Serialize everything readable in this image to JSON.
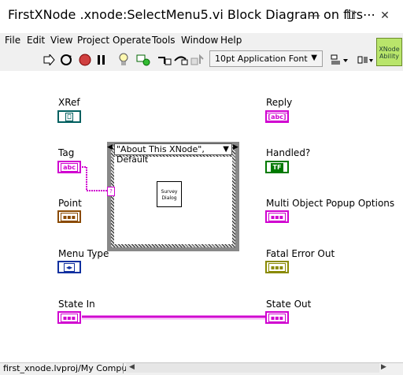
{
  "window": {
    "title": "FirstXNode .xnode:SelectMenu5.vi Block Diagram on firs⋯",
    "minimize": "—",
    "maximize": "☐",
    "close": "✕"
  },
  "menubar": [
    "File",
    "Edit",
    "View",
    "Project",
    "Operate",
    "Tools",
    "Window",
    "Help"
  ],
  "toolbar": {
    "font_select": "10pt Application Font",
    "xnode_ability": [
      "XNode",
      "Ability"
    ]
  },
  "diagram": {
    "terminals": {
      "xref": {
        "label": "XRef",
        "type": "⎕"
      },
      "tag": {
        "label": "Tag",
        "type": "abc"
      },
      "point": {
        "label": "Point",
        "type": "▪▪▪"
      },
      "menu_type": {
        "label": "Menu Type",
        "type": "◂▸"
      },
      "state_in": {
        "label": "State In",
        "type": "▪▪▪"
      },
      "reply": {
        "label": "Reply",
        "type": "[abc]"
      },
      "handled": {
        "label": "Handled?",
        "type": "TF"
      },
      "popup_options": {
        "label": "Multi Object Popup Options",
        "type": "▪▪▪"
      },
      "fatal_error": {
        "label": "Fatal Error Out",
        "type": "▪▪▪"
      },
      "state_out": {
        "label": "State Out",
        "type": "▪▪▪"
      }
    },
    "case_selector": "\"About This XNode\", Default",
    "subvi": [
      "Survey",
      "Dialog"
    ],
    "tunnel_mark": "?"
  },
  "statusbar": {
    "path": "first_xnode.lvproj/My Computer"
  },
  "colors": {
    "string": "#d000d0",
    "boolean": "#007a00",
    "cluster": "#8a4a00",
    "enum": "#1030a0",
    "error": "#8a8a00",
    "refnum": "#006060",
    "xnode_green": "#b9e56b"
  }
}
